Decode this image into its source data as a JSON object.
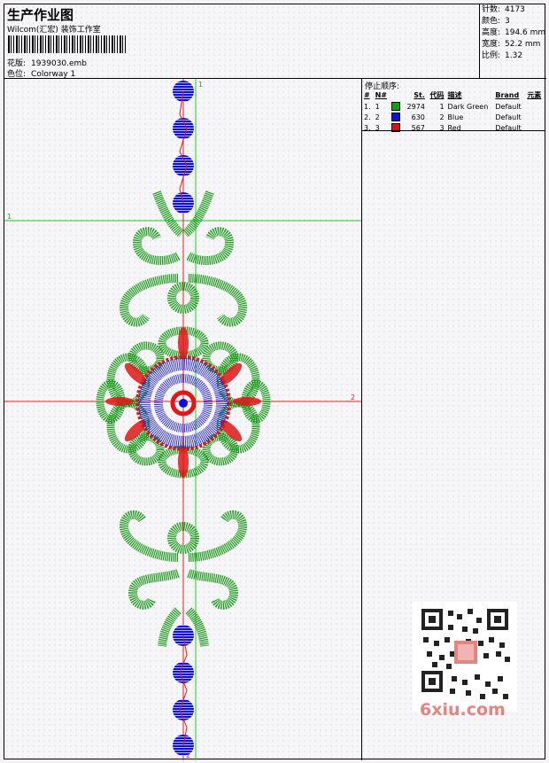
{
  "header": {
    "title": "生产作业图",
    "company": "Wilcom(汇宏) 装饰工作室",
    "design_label": "花版:",
    "design_value": "1939030.emb",
    "colorway_label": "色位:",
    "colorway_value": "Colorway 1"
  },
  "stats": {
    "stitches_label": "针数:",
    "stitches_value": "4173",
    "colors_label": "颜色:",
    "colors_value": "3",
    "height_label": "高度:",
    "height_value": "194.6 mm",
    "width_label": "宽度:",
    "width_value": "52.2 mm",
    "ratio_label": "比例:",
    "ratio_value": "1.32"
  },
  "guides": {
    "v1": "1",
    "h1": "1",
    "h2": "2",
    "v2": "2",
    "colors": {
      "green_guide": "#22cc22",
      "red_guide": "#ee2222"
    }
  },
  "stop_sequence": {
    "title": "停止顺序:",
    "headers": [
      "#",
      "N#",
      "St.",
      "代码",
      "描述",
      "Brand",
      "元素"
    ],
    "rows": [
      {
        "idx": "1.",
        "n": "1",
        "color": "#10a010",
        "st": "2974",
        "code": "1",
        "desc": "Dark Green",
        "brand": "Default",
        "elem": ""
      },
      {
        "idx": "2.",
        "n": "2",
        "color": "#1010e0",
        "st": "630",
        "code": "2",
        "desc": "Blue",
        "brand": "Default",
        "elem": ""
      },
      {
        "idx": "3.",
        "n": "3",
        "color": "#e01010",
        "st": "567",
        "code": "3",
        "desc": "Red",
        "brand": "Default",
        "elem": ""
      }
    ]
  },
  "thread_colors": {
    "green": "#1a9a1a",
    "blue": "#1010dd",
    "red": "#e01818"
  },
  "watermark": {
    "logo_text": "6xiu.com"
  }
}
